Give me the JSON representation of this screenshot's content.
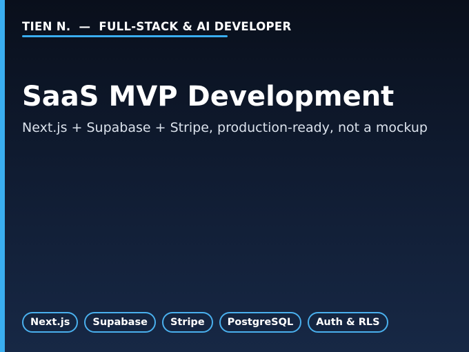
{
  "colors": {
    "accent": "#3aaef0",
    "underline": "#3aaef0"
  },
  "header": {
    "text": "TIEN N.  —  FULL-STACK & AI DEVELOPER"
  },
  "title": "SaaS MVP Development",
  "subtitle": "Next.js + Supabase + Stripe, production-ready, not a mockup",
  "tags": [
    "Next.js",
    "Supabase",
    "Stripe",
    "PostgreSQL",
    "Auth & RLS"
  ]
}
